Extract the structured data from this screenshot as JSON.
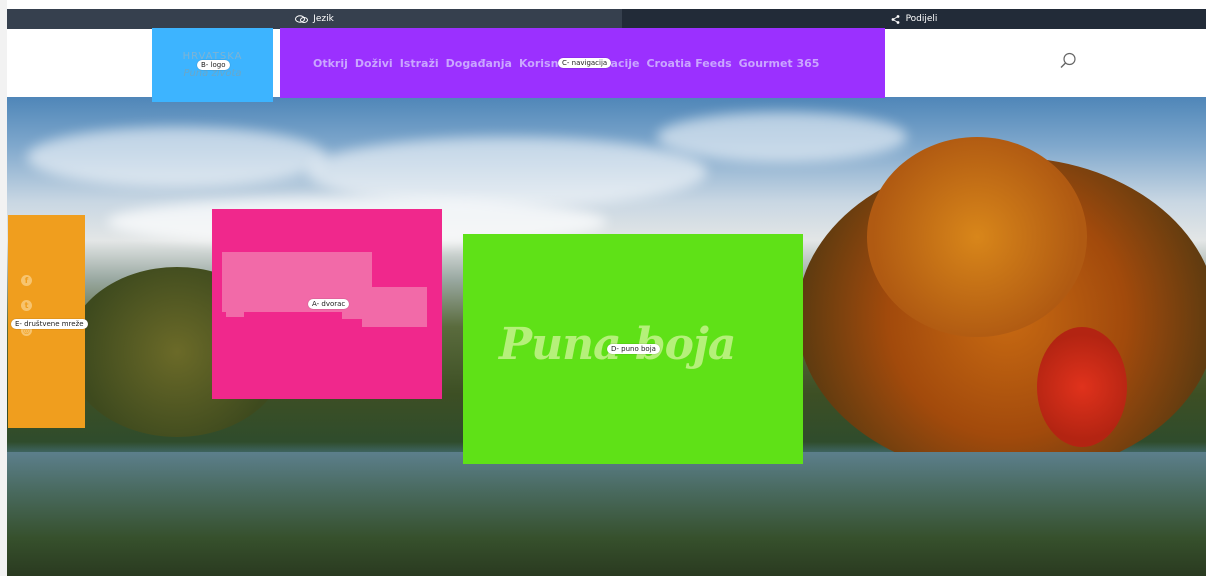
{
  "topbar": {
    "language_label": "Jezik",
    "share_label": "Podijeli"
  },
  "header": {
    "logo_top": "HRVATSKA",
    "logo_tagline": "Puna života",
    "nav": [
      {
        "label": "Otkrij"
      },
      {
        "label": "Doživi"
      },
      {
        "label": "Istraži"
      },
      {
        "label": "Događanja"
      },
      {
        "label": "Korisne informacije"
      },
      {
        "label": "Croatia Feeds"
      },
      {
        "label": "Gourmet 365"
      }
    ]
  },
  "hero": {
    "slogan": "Puna boja"
  },
  "annotations": {
    "logo": "B- logo",
    "navigation": "C- navigacija",
    "castle": "A- dvorac",
    "full_color": "D- puno boja",
    "social": "E- društvene mreže"
  },
  "colors": {
    "logo_overlay": "#3db4ff",
    "nav_overlay": "#9b30ff",
    "castle_overlay": "#f0288c",
    "slogan_overlay": "#5fe117",
    "social_overlay": "#f09e1e"
  },
  "icons": [
    "chat-icon",
    "share-icon",
    "search-icon",
    "facebook-icon",
    "twitter-icon",
    "instagram-icon"
  ]
}
